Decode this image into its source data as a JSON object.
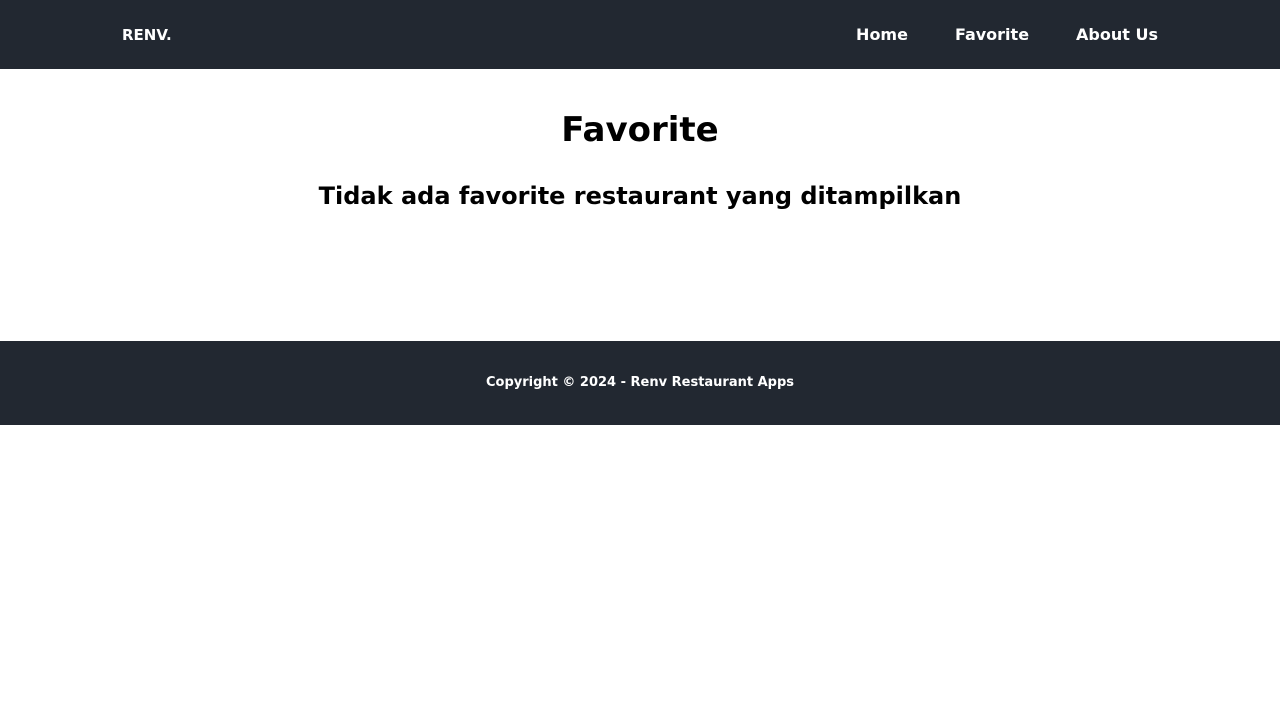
{
  "colors": {
    "nav_background": "#222831",
    "footer_background": "#222831",
    "nav_text": "#ffffff",
    "page_background": "#ffffff",
    "body_text": "#000000"
  },
  "header": {
    "brand": "RENV.",
    "nav": [
      {
        "label": "Home"
      },
      {
        "label": "Favorite"
      },
      {
        "label": "About Us"
      }
    ]
  },
  "main": {
    "title": "Favorite",
    "empty_message": "Tidak ada favorite restaurant yang ditampilkan"
  },
  "footer": {
    "copyright": "Copyright © 2024 - Renv Restaurant Apps"
  }
}
